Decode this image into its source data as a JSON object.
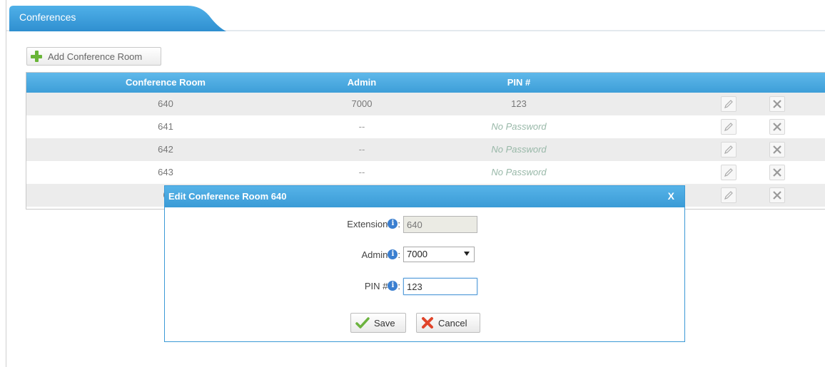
{
  "tab": {
    "label": "Conferences"
  },
  "toolbar": {
    "add_label": "Add Conference Room"
  },
  "table": {
    "headers": {
      "room": "Conference Room",
      "admin": "Admin",
      "pin": "PIN #"
    },
    "rows": [
      {
        "room": "640",
        "admin": "7000",
        "pin": "123"
      },
      {
        "room": "641",
        "admin": "--",
        "pin": "No Password"
      },
      {
        "room": "642",
        "admin": "--",
        "pin": "No Password"
      },
      {
        "room": "643",
        "admin": "--",
        "pin": "No Password"
      },
      {
        "room": "6",
        "admin": "",
        "pin": ""
      }
    ]
  },
  "dialog": {
    "title": "Edit Conference Room 640",
    "close": "X",
    "extension": {
      "label": "Extension",
      "value": "640"
    },
    "admin": {
      "label": "Admin",
      "value": "7000"
    },
    "pin": {
      "label": "PIN #",
      "value": "123"
    },
    "info_glyph": "i",
    "colon": ":",
    "save_label": "Save",
    "cancel_label": "Cancel"
  },
  "colors": {
    "header_blue": "#3d9ed8",
    "accent_green": "#69b538",
    "cancel_red": "#e0442a",
    "no_password": "#98b8a8"
  },
  "icons": {
    "add": "plus-icon",
    "edit": "pencil-icon",
    "delete": "delete-x-icon",
    "info": "info-icon",
    "save": "checkmark-icon",
    "cancel": "cancel-x-icon"
  }
}
